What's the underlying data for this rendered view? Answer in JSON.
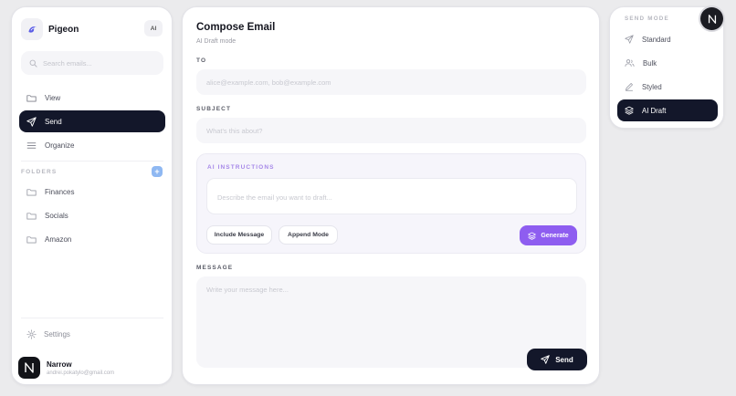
{
  "sidebar": {
    "app_name": "Pigeon",
    "ai_badge": "AI",
    "search_placeholder": "Search emails...",
    "nav": [
      {
        "label": "View",
        "icon": "folder-icon"
      },
      {
        "label": "Send",
        "icon": "send-icon",
        "active": true
      },
      {
        "label": "Organize",
        "icon": "menu-icon"
      }
    ],
    "folders_label": "FOLDERS",
    "add_folder": "+",
    "folders": [
      {
        "label": "Finances",
        "icon": "folder-icon"
      },
      {
        "label": "Socials",
        "icon": "folder-icon"
      },
      {
        "label": "Amazon",
        "icon": "folder-icon"
      }
    ],
    "settings_label": "Settings",
    "user": {
      "name": "Narrow",
      "email": "andrei.pokatylo@gmail.com"
    }
  },
  "compose": {
    "title": "Compose Email",
    "subtitle": "AI Draft mode",
    "to_label": "TO",
    "to_placeholder": "alice@example.com, bob@example.com",
    "subject_label": "SUBJECT",
    "subject_placeholder": "What's this about?",
    "ai": {
      "label": "AI INSTRUCTIONS",
      "placeholder": "Describe the email you want to draft...",
      "include_label": "Include Message",
      "append_label": "Append Mode",
      "generate_label": "Generate"
    },
    "message_label": "MESSAGE",
    "message_placeholder": "Write your message here...",
    "send_label": "Send"
  },
  "send_mode": {
    "label": "SEND MODE",
    "items": [
      {
        "label": "Standard",
        "icon": "send-icon"
      },
      {
        "label": "Bulk",
        "icon": "users-icon"
      },
      {
        "label": "Styled",
        "icon": "pen-icon"
      },
      {
        "label": "AI Draft",
        "icon": "layers-icon",
        "active": true
      }
    ]
  },
  "colors": {
    "accent_dark": "#13172a",
    "ai_purple": "#8e5df0",
    "add_blue": "#8fb8f2"
  }
}
